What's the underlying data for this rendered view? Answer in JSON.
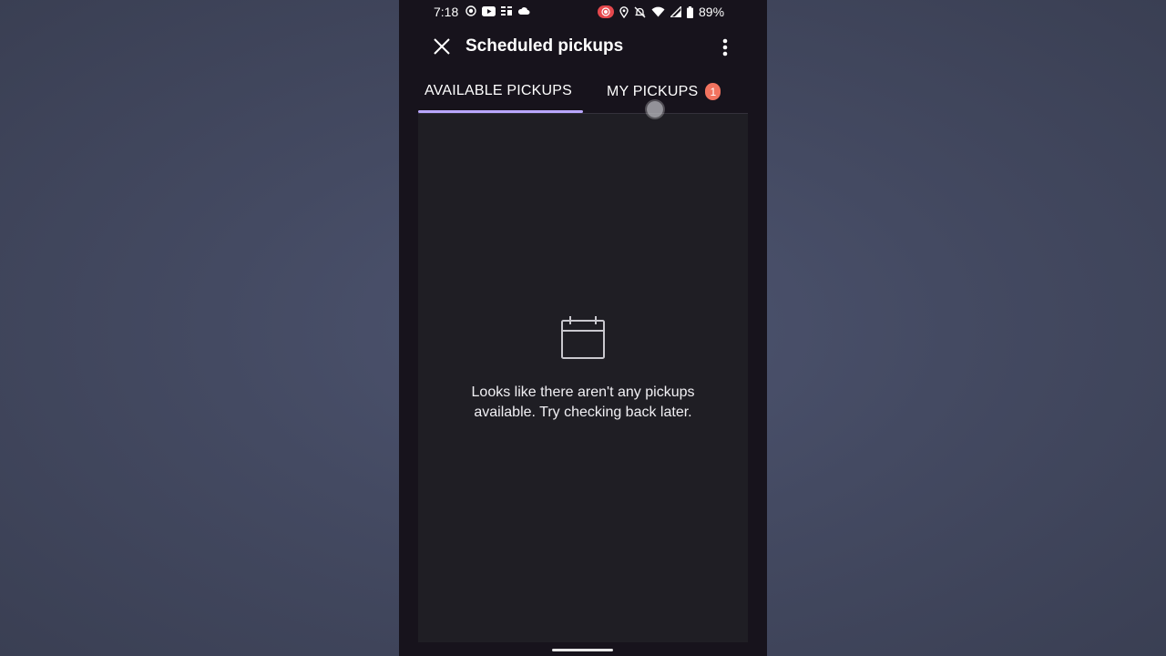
{
  "status_bar": {
    "time": "7:18",
    "battery": "89%",
    "icons_left": [
      "screen-record-icon",
      "youtube-icon",
      "app-grid-icon",
      "cloud-icon"
    ],
    "icons_right": [
      "recording-icon",
      "location-icon",
      "bell-off-icon",
      "wifi-icon",
      "signal-icon",
      "battery-icon"
    ]
  },
  "toolbar": {
    "title": "Scheduled pickups",
    "close_icon": "close-icon",
    "overflow_icon": "more-vert-icon"
  },
  "tabs": [
    {
      "label": "AVAILABLE PICKUPS",
      "selected": true
    },
    {
      "label": "MY PICKUPS",
      "badge": "1",
      "selected": false
    }
  ],
  "empty_state": {
    "icon": "calendar-icon",
    "message": "Looks like there aren't any pickups available. Try checking back later."
  },
  "colors": {
    "accent": "#b9a7ff",
    "badge": "#f2735f",
    "app_background": "#17131c",
    "content_background": "#1f1e24"
  }
}
